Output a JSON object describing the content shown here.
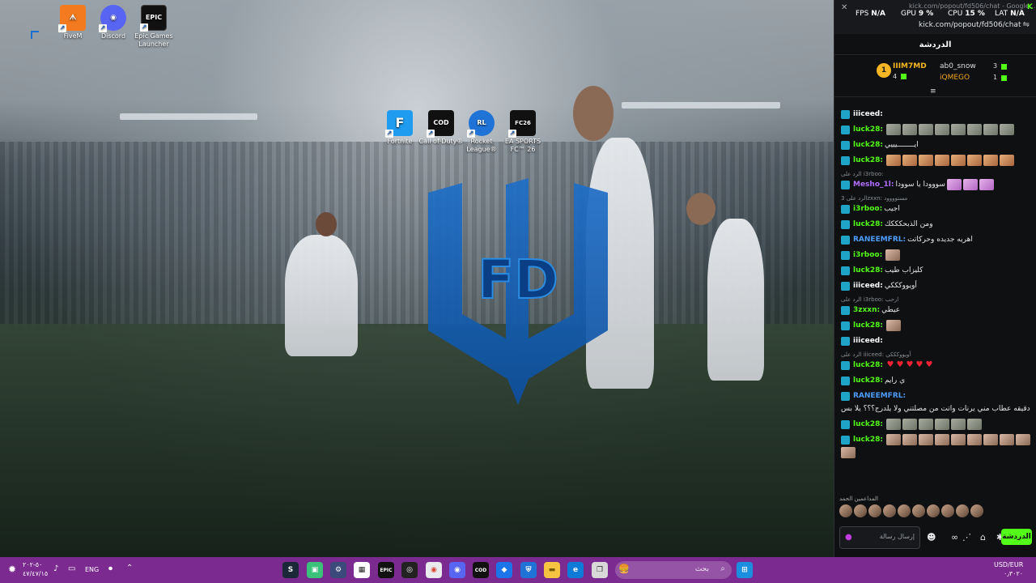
{
  "desktop": {
    "icons_top_left": [
      {
        "label": "FiveM",
        "glyph": "ᗑ",
        "color": "#f37a1f"
      },
      {
        "label": "Discord",
        "glyph": "◉",
        "color": "#5865f2"
      },
      {
        "label": "Epic Games Launcher",
        "glyph": "EPIC",
        "color": "#111111"
      }
    ],
    "icons_center": [
      {
        "label": "Fortnite",
        "glyph": "F",
        "color": "#1f9cf0"
      },
      {
        "label": "Call of Duty®",
        "glyph": "COD",
        "color": "#111111"
      },
      {
        "label": "Rocket League®",
        "glyph": "RL",
        "color": "#1f73d6"
      },
      {
        "label": "EA SPORTS FC™ 26",
        "glyph": "FC26",
        "color": "#111111"
      }
    ]
  },
  "overlay": {
    "fps_label": "FPS",
    "fps_value": "N/A",
    "gpu_label": "GPU",
    "gpu_value": "9 %",
    "cpu_label": "CPU",
    "cpu_value": "15 %",
    "lat_label": "LAT",
    "lat_value": "N/A",
    "window_title": "kick.com/popout/fd506/chat - Google...",
    "url": "kick.com/popout/fd506/chat"
  },
  "chat": {
    "title": "الدردشة",
    "leaderboard": [
      {
        "rank": "1",
        "name": "IIIM7MD",
        "count": "4"
      },
      {
        "name": "ab0_snow",
        "count": "3"
      },
      {
        "name": "iQMEGO",
        "count": "1"
      }
    ],
    "messages": [
      {
        "user": "iiiceed:",
        "text": "",
        "color": "#ffffff"
      },
      {
        "user": "luck28:",
        "text": "",
        "color": "#53fc18",
        "emotes": "gggggggg"
      },
      {
        "user": "luck28:",
        "text": "ايــــــــيييي",
        "color": "#53fc18"
      },
      {
        "user": "luck28:",
        "text": "",
        "color": "#53fc18",
        "emotes": "oooooooo"
      },
      {
        "reply": "الرد على i3rboo:",
        "user": "Mesho_1l:",
        "text": "سووودا يا سوودا",
        "color": "#b16dff",
        "emotes": "ppp"
      },
      {
        "reply": "الرد على 3zxxn: مستوووود",
        "user": "i3rboo:",
        "text": "اجيب",
        "color": "#53fc18"
      },
      {
        "user": "luck28:",
        "text": "ومن الذبحكككك",
        "color": "#53fc18"
      },
      {
        "user": "RANEEMFRL:",
        "text": "اهريه جديده وحركاتت",
        "color": "#4d9cff"
      },
      {
        "user": "i3rboo:",
        "text": "",
        "color": "#53fc18",
        "emotes": "f"
      },
      {
        "user": "luck28:",
        "text": "كليزاب طيب",
        "color": "#53fc18"
      },
      {
        "user": "iiiceed:",
        "text": "أويووكككي",
        "color": "#ffffff"
      },
      {
        "reply": "الرد على i3rboo: ارحب",
        "user": "3zxxn:",
        "text": "عيطي",
        "color": "#53fc18"
      },
      {
        "user": "luck28:",
        "text": "",
        "color": "#53fc18",
        "emotes": "f"
      },
      {
        "user": "iiiceed:",
        "text": "",
        "color": "#ffffff"
      },
      {
        "reply": "الرد على iiiceed: أويووكككي",
        "user": "luck28:",
        "text": "",
        "color": "#53fc18",
        "emotes": "rrrrr"
      },
      {
        "user": "luck28:",
        "text": "ي رايم",
        "color": "#53fc18"
      },
      {
        "user": "RANEEMFRL:",
        "text": "دقيقه عطاب مني يرنات واتت من مصلتني ولا يلدرج؟؟؟ يلا بس",
        "color": "#4d9cff"
      },
      {
        "user": "luck28:",
        "text": "",
        "color": "#53fc18",
        "emotes": "gggggg"
      },
      {
        "user": "luck28:",
        "text": "",
        "color": "#53fc18",
        "emotes": "ffffffffff"
      }
    ],
    "supporters_label": "المداعمين الحمد",
    "input_placeholder": "إرسال رسالة",
    "chat_button": "الدردشة"
  },
  "taskbar": {
    "weather_line1": "٥٠-٢٠٢",
    "weather_line2": "٤٧/٤٧/١٥",
    "lang": "ENG",
    "search_placeholder": "بحث",
    "tray_line1": "USD/EUR",
    "tray_line2": "٠٫٣٠٢٠"
  }
}
